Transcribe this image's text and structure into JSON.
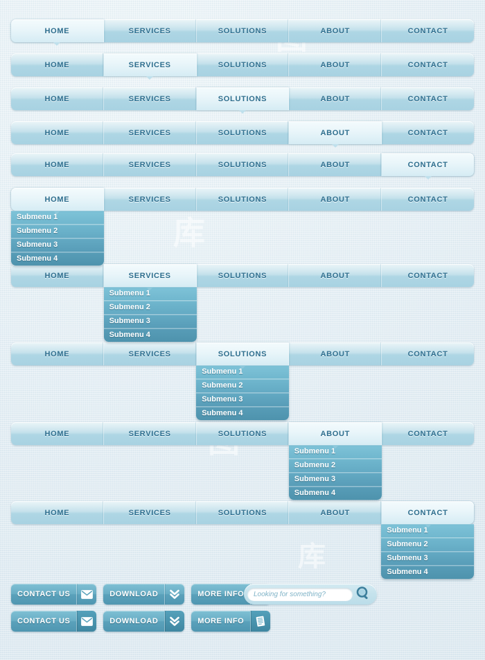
{
  "theme": {
    "background": "#e6eff4",
    "nav_gradient_top": "#cfe7ef",
    "nav_gradient_bottom": "#a8d2e2",
    "tab_text_color": "#2f6f8f",
    "submenu_top": "#7ec3d8",
    "submenu_bottom": "#4e93ad",
    "button_top": "#7fc0d4",
    "button_bottom": "#4f96b1",
    "button_text_color": "#ffffff"
  },
  "watermarks": [
    "图",
    "库",
    "图",
    "库"
  ],
  "nav": {
    "tabs": [
      {
        "label": "HOME"
      },
      {
        "label": "SERVICES"
      },
      {
        "label": "SOLUTIONS"
      },
      {
        "label": "ABOUT"
      },
      {
        "label": "CONTACT"
      }
    ],
    "submenu_items": [
      {
        "label": "Submenu 1"
      },
      {
        "label": "Submenu 2"
      },
      {
        "label": "Submenu 3"
      },
      {
        "label": "Submenu 4"
      }
    ],
    "rows": [
      {
        "active_index": 0,
        "submenu_open": false
      },
      {
        "active_index": 1,
        "submenu_open": false
      },
      {
        "active_index": 2,
        "submenu_open": false
      },
      {
        "active_index": 3,
        "submenu_open": false
      },
      {
        "active_index": 4,
        "submenu_open": false
      },
      {
        "active_index": 0,
        "submenu_open": true
      },
      {
        "active_index": 1,
        "submenu_open": true
      },
      {
        "active_index": 2,
        "submenu_open": true
      },
      {
        "active_index": 3,
        "submenu_open": true
      },
      {
        "active_index": 4,
        "submenu_open": true
      }
    ]
  },
  "buttons": {
    "row1": [
      {
        "label": "CONTACT US",
        "icon": "envelope-icon",
        "style": "light"
      },
      {
        "label": "DOWNLOAD",
        "icon": "double-chevron-down-icon",
        "style": "light"
      },
      {
        "label": "MORE INFO",
        "icon": "document-icon",
        "style": "light"
      }
    ],
    "row2": [
      {
        "label": "CONTACT US",
        "icon": "envelope-icon",
        "style": "dark"
      },
      {
        "label": "DOWNLOAD",
        "icon": "double-chevron-down-icon",
        "style": "dark"
      },
      {
        "label": "MORE INFO",
        "icon": "document-icon",
        "style": "dark"
      }
    ]
  },
  "search": {
    "placeholder": "Looking for something?",
    "value": "",
    "icon": "magnifier-icon"
  }
}
